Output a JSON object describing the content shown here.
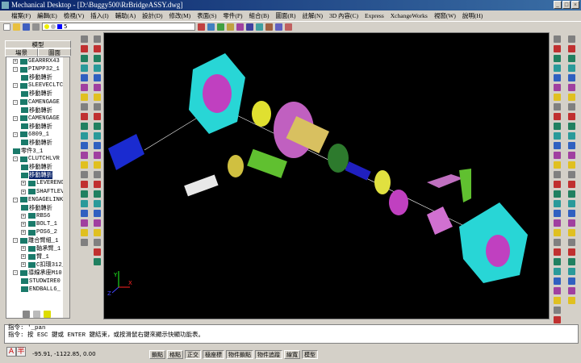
{
  "title": "Mechanical Desktop - [D:\\Buggy500\\RrBridgeASSY.dwg]",
  "menu": [
    "檔案(F)",
    "編輯(E)",
    "檢視(V)",
    "插入(I)",
    "輔助(A)",
    "設計(D)",
    "修改(M)",
    "表面(S)",
    "零件(P)",
    "組合(B)",
    "圖面(R)",
    "註解(N)",
    "3D 內容(C)",
    "Express",
    "XchangeWorks",
    "視窗(W)",
    "說明(H)"
  ],
  "layer": {
    "value": "5",
    "color": "#0000ff"
  },
  "browser": {
    "tab_model": "模型",
    "tab_scene": "場景",
    "tab_drawing": "圖面",
    "tree": [
      {
        "label": "GEARRRX43",
        "ex": "+",
        "lvl": 1
      },
      {
        "label": "PINPP32_1",
        "ex": "-",
        "lvl": 1
      },
      {
        "label": "移動轉折",
        "lvl": 2
      },
      {
        "label": "SLEEVECLTC",
        "ex": "-",
        "lvl": 1
      },
      {
        "label": "移動轉折",
        "lvl": 2
      },
      {
        "label": "CAMENGAGE",
        "ex": "-",
        "lvl": 1
      },
      {
        "label": "移動轉折",
        "lvl": 2
      },
      {
        "label": "CAMENGAGE",
        "ex": "-",
        "lvl": 1
      },
      {
        "label": "移動轉折",
        "lvl": 2
      },
      {
        "label": "6809_1",
        "ex": "-",
        "lvl": 1
      },
      {
        "label": "移動轉折",
        "lvl": 2
      },
      {
        "label": "零件3_1",
        "lvl": 1
      },
      {
        "label": "CLUTCHLVR",
        "ex": "-",
        "lvl": 1
      },
      {
        "label": "移動轉折",
        "lvl": 2
      },
      {
        "label": "移動轉折",
        "lvl": 2,
        "selected": true
      },
      {
        "label": "LEVERENG",
        "ex": "+",
        "lvl": 2
      },
      {
        "label": "SHAFTLEV",
        "ex": "+",
        "lvl": 2
      },
      {
        "label": "ENGAGELINK",
        "ex": "-",
        "lvl": 1
      },
      {
        "label": "移動轉折",
        "lvl": 2
      },
      {
        "label": "RBS6",
        "ex": "+",
        "lvl": 2
      },
      {
        "label": "BOLT_1",
        "ex": "+",
        "lvl": 2
      },
      {
        "label": "POS6_2",
        "ex": "+",
        "lvl": 2
      },
      {
        "label": "離合臂組_1",
        "ex": "-",
        "lvl": 1
      },
      {
        "label": "軸承臂_1",
        "ex": "+",
        "lvl": 2
      },
      {
        "label": "臂_1",
        "ex": "+",
        "lvl": 2
      },
      {
        "label": "C扣環312_",
        "ex": "+",
        "lvl": 2
      },
      {
        "label": "導線承座M10",
        "ex": "-",
        "lvl": 1
      },
      {
        "label": "STUDWIRE0",
        "lvl": 2
      },
      {
        "label": "ENDBALL6_",
        "lvl": 2
      }
    ]
  },
  "command": {
    "line1": "指令:  '_pan",
    "line2": "指令:  按 ESC 鍵或 ENTER 鍵結束，或按滑鼠右鍵來顯示快顯功能表。"
  },
  "ime": [
    "A",
    "半"
  ],
  "status": {
    "coords": "-95.91, -1122.85, 0.00",
    "toggles": [
      {
        "label": "鎖點",
        "on": false
      },
      {
        "label": "格點",
        "on": false
      },
      {
        "label": "正交",
        "on": true
      },
      {
        "label": "極座標",
        "on": true
      },
      {
        "label": "物件鎖點",
        "on": true
      },
      {
        "label": "物件追蹤",
        "on": true
      },
      {
        "label": "線寬",
        "on": false
      },
      {
        "label": "模型",
        "on": true
      }
    ]
  },
  "ucs": {
    "x": "X",
    "y": "Y",
    "z": "Z"
  }
}
